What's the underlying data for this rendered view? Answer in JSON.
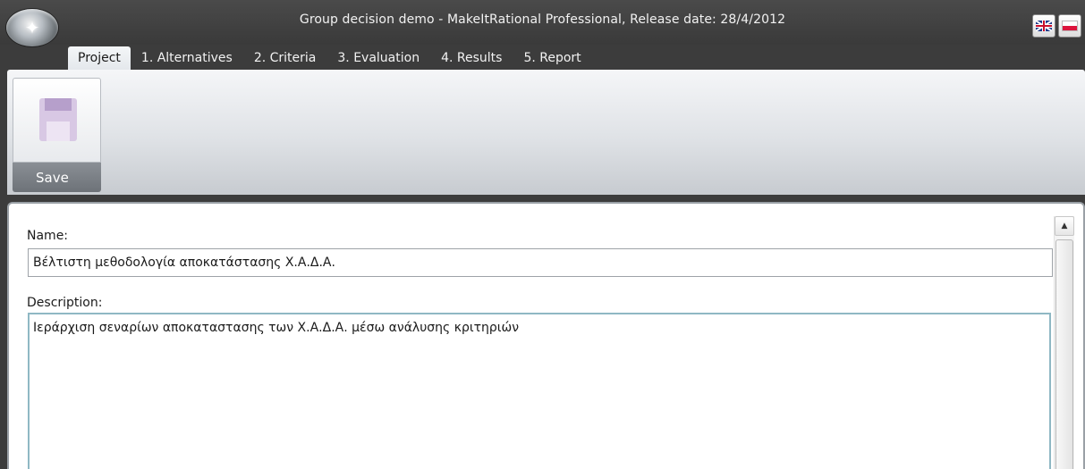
{
  "window": {
    "title": "Group decision demo - MakeItRational Professional, Release date: 28/4/2012",
    "language_buttons": [
      {
        "icon": "uk-flag-icon"
      },
      {
        "icon": "pl-flag-icon"
      }
    ]
  },
  "tabs": [
    {
      "label": "Project",
      "active": true
    },
    {
      "label": "1. Alternatives",
      "active": false
    },
    {
      "label": "2. Criteria",
      "active": false
    },
    {
      "label": "3. Evaluation",
      "active": false
    },
    {
      "label": "4. Results",
      "active": false
    },
    {
      "label": "5. Report",
      "active": false
    }
  ],
  "ribbon": {
    "save_label": "Save",
    "save_icon": "floppy-disk-icon"
  },
  "form": {
    "name_label": "Name:",
    "name_value": "Βέλτιστη μεθοδολογία αποκατάστασης Χ.Α.Δ.Α.",
    "description_label": "Description:",
    "description_value": "Ιεράρχιση σεναρίων αποκαταστασης των Χ.Α.Δ.Α. μέσω ανάλυσης κριτηριών"
  },
  "colors": {
    "titlebar": "#3c3c3c",
    "active_tab": "#eef1f4",
    "description_border": "#8fb8c4"
  }
}
